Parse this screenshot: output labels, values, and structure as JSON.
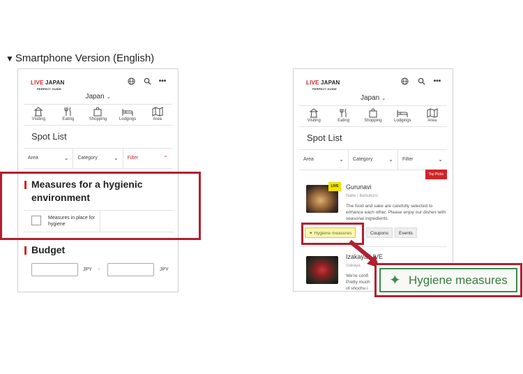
{
  "heading": "Smartphone Version (English)",
  "logo": {
    "main_red": "LIVE",
    "main_rest": " JAPAN",
    "sub": "PERFECT GUIDE"
  },
  "header_icons": [
    "globe-icon",
    "search-icon",
    "more-icon"
  ],
  "region": "Japan",
  "nav": [
    {
      "label": "Visiting",
      "icon": "visiting-icon"
    },
    {
      "label": "Eating",
      "icon": "eating-icon"
    },
    {
      "label": "Shopping",
      "icon": "shopping-icon"
    },
    {
      "label": "Lodgings",
      "icon": "lodgings-icon"
    },
    {
      "label": "Area",
      "icon": "area-icon"
    }
  ],
  "spot_list_title": "Spot List",
  "filters": {
    "area": "Area",
    "category": "Category",
    "filter": "Filter"
  },
  "left": {
    "hygiene_section_title": "Measures for a hygienic environment",
    "hygiene_checkbox_label": "Measures in place for hygiene",
    "budget_title": "Budget",
    "currency": "JPY",
    "range_separator": "-"
  },
  "right": {
    "top_picks": "Top Picks",
    "live_badge": "LIVE",
    "card1": {
      "title": "Gurunavi",
      "subtitle": "Nabe / Ikebukuro",
      "description": "The food and sake are carefully selected to enhance each other. Please enjoy our dishes with seasonal ingredients."
    },
    "tags": [
      "Hygiene measures",
      "Coupons",
      "Events"
    ],
    "card2": {
      "title": "Izakaya LIVE",
      "subtitle": "Izakaya",
      "description_lines": [
        "We're confi",
        "Pretty much",
        "of shochu i"
      ]
    },
    "zoom_label": "Hygiene measures"
  },
  "colors": {
    "accent_red": "#d2232a",
    "frame_red": "#b31f2e",
    "hygiene_green": "#3b8a4b",
    "hygiene_yellow": "#fff7b0"
  }
}
